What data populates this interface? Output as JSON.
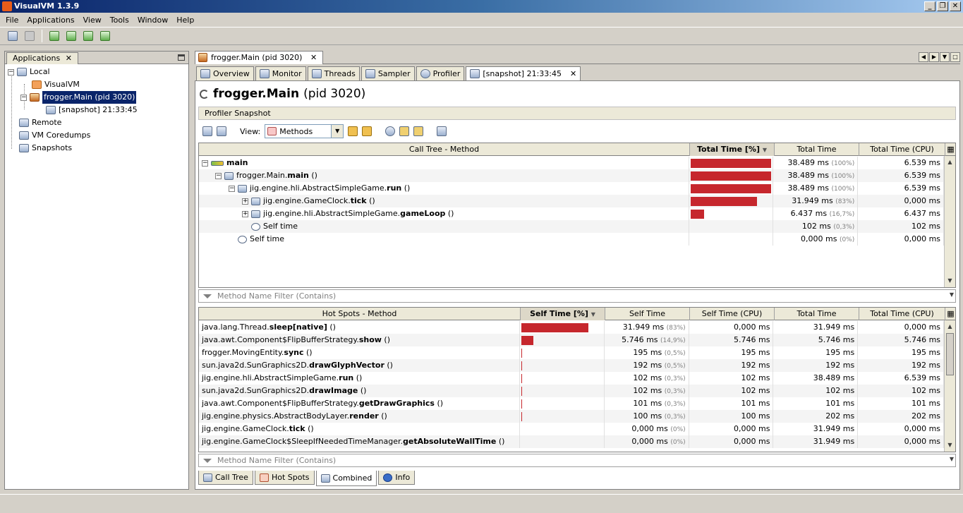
{
  "window": {
    "title": "VisualVM 1.3.9",
    "controls": [
      "_",
      "❐",
      "✕"
    ]
  },
  "menu": [
    "File",
    "Applications",
    "View",
    "Tools",
    "Window",
    "Help"
  ],
  "toolbar_icons": [
    "open-icon",
    "save-icon",
    "add-jmx-icon",
    "add-remote-icon",
    "add-coredump-icon",
    "add-snapshot-icon"
  ],
  "left_panel": {
    "tab_label": "Applications",
    "tab_close": "✕",
    "tree": [
      {
        "label": "Local",
        "level": 0,
        "expander": "−"
      },
      {
        "label": "VisualVM",
        "level": 1
      },
      {
        "label": "frogger.Main (pid 3020)",
        "level": 1,
        "expander": "−",
        "selected": true
      },
      {
        "label": "[snapshot] 21:33:45",
        "level": 2
      },
      {
        "label": "Remote",
        "level": 0
      },
      {
        "label": "VM Coredumps",
        "level": 0
      },
      {
        "label": "Snapshots",
        "level": 0
      }
    ]
  },
  "doc_tab": {
    "label": "frogger.Main (pid 3020)",
    "close": "✕",
    "nav": [
      "◀",
      "▶",
      "▼",
      "□"
    ]
  },
  "sub_tabs": [
    {
      "label": "Overview"
    },
    {
      "label": "Monitor"
    },
    {
      "label": "Threads"
    },
    {
      "label": "Sampler"
    },
    {
      "label": "Profiler"
    },
    {
      "label": "[snapshot] 21:33:45",
      "close": "✕",
      "active": true
    }
  ],
  "page": {
    "title_bold": "frogger.Main",
    "title_rest": "(pid 3020)",
    "section": "Profiler Snapshot",
    "view_label": "View:",
    "view_value": "Methods"
  },
  "call_tree": {
    "headers": [
      "Call Tree - Method",
      "Total Time [%]",
      "Total Time",
      "Total Time (CPU)"
    ],
    "sort_arrow": "▼",
    "rows": [
      {
        "prefix": "",
        "bold": "main",
        "suffix": "",
        "indent": 0,
        "expander": "−",
        "icon": "thread-icon",
        "pct": 100,
        "time": "38.489 ms",
        "pct_label": "(100%)",
        "cpu": "6.539 ms"
      },
      {
        "prefix": "frogger.Main.",
        "bold": "main",
        "suffix": " ()",
        "indent": 1,
        "expander": "−",
        "icon": "method-icon",
        "pct": 100,
        "time": "38.489 ms",
        "pct_label": "(100%)",
        "cpu": "6.539 ms"
      },
      {
        "prefix": "jig.engine.hli.AbstractSimpleGame.",
        "bold": "run",
        "suffix": " ()",
        "indent": 2,
        "expander": "−",
        "icon": "method-icon",
        "pct": 100,
        "time": "38.489 ms",
        "pct_label": "(100%)",
        "cpu": "6.539 ms"
      },
      {
        "prefix": "jig.engine.GameClock.",
        "bold": "tick",
        "suffix": " ()",
        "indent": 3,
        "expander": "+",
        "icon": "method-icon",
        "pct": 83,
        "time": "31.949 ms",
        "pct_label": "(83%)",
        "cpu": "0,000 ms"
      },
      {
        "prefix": "jig.engine.hli.AbstractSimpleGame.",
        "bold": "gameLoop",
        "suffix": " ()",
        "indent": 3,
        "expander": "+",
        "icon": "method-icon",
        "pct": 16.7,
        "time": "6.437 ms",
        "pct_label": "(16,7%)",
        "cpu": "6.437 ms"
      },
      {
        "prefix": "Self time",
        "bold": "",
        "suffix": "",
        "indent": 3,
        "expander": "",
        "icon": "clock-icon",
        "pct": 0.3,
        "time": "102 ms",
        "pct_label": "(0,3%)",
        "cpu": "102 ms"
      },
      {
        "prefix": "Self time",
        "bold": "",
        "suffix": "",
        "indent": 2,
        "expander": "",
        "icon": "clock-icon",
        "pct": 0,
        "time": "0,000 ms",
        "pct_label": "(0%)",
        "cpu": "0,000 ms"
      }
    ]
  },
  "filter_placeholder": "Method Name Filter (Contains)",
  "hot_spots": {
    "headers": [
      "Hot Spots - Method",
      "Self Time [%]",
      "Self Time",
      "Self Time (CPU)",
      "Total Time",
      "Total Time (CPU)"
    ],
    "sort_arrow": "▼",
    "rows": [
      {
        "prefix": "java.lang.Thread.",
        "bold": "sleep[native]",
        "suffix": " ()",
        "pct": 83,
        "self": "31.949 ms",
        "pct_label": "(83%)",
        "self_cpu": "0,000 ms",
        "total": "31.949 ms",
        "total_cpu": "0,000 ms"
      },
      {
        "prefix": "java.awt.Component$FlipBufferStrategy.",
        "bold": "show",
        "suffix": " ()",
        "pct": 14.9,
        "self": "5.746 ms",
        "pct_label": "(14,9%)",
        "self_cpu": "5.746 ms",
        "total": "5.746 ms",
        "total_cpu": "5.746 ms"
      },
      {
        "prefix": "frogger.MovingEntity.",
        "bold": "sync",
        "suffix": " ()",
        "pct": 0.5,
        "self": "195 ms",
        "pct_label": "(0,5%)",
        "self_cpu": "195 ms",
        "total": "195 ms",
        "total_cpu": "195 ms"
      },
      {
        "prefix": "sun.java2d.SunGraphics2D.",
        "bold": "drawGlyphVector",
        "suffix": " ()",
        "pct": 0.5,
        "self": "192 ms",
        "pct_label": "(0,5%)",
        "self_cpu": "192 ms",
        "total": "192 ms",
        "total_cpu": "192 ms"
      },
      {
        "prefix": "jig.engine.hli.AbstractSimpleGame.",
        "bold": "run",
        "suffix": " ()",
        "pct": 0.3,
        "self": "102 ms",
        "pct_label": "(0,3%)",
        "self_cpu": "102 ms",
        "total": "38.489 ms",
        "total_cpu": "6.539 ms"
      },
      {
        "prefix": "sun.java2d.SunGraphics2D.",
        "bold": "drawImage",
        "suffix": " ()",
        "pct": 0.3,
        "self": "102 ms",
        "pct_label": "(0,3%)",
        "self_cpu": "102 ms",
        "total": "102 ms",
        "total_cpu": "102 ms"
      },
      {
        "prefix": "java.awt.Component$FlipBufferStrategy.",
        "bold": "getDrawGraphics",
        "suffix": " ()",
        "pct": 0.3,
        "self": "101 ms",
        "pct_label": "(0,3%)",
        "self_cpu": "101 ms",
        "total": "101 ms",
        "total_cpu": "101 ms"
      },
      {
        "prefix": "jig.engine.physics.AbstractBodyLayer.",
        "bold": "render",
        "suffix": " ()",
        "pct": 0.3,
        "self": "100 ms",
        "pct_label": "(0,3%)",
        "self_cpu": "100 ms",
        "total": "202 ms",
        "total_cpu": "202 ms"
      },
      {
        "prefix": "jig.engine.GameClock.",
        "bold": "tick",
        "suffix": " ()",
        "pct": 0,
        "self": "0,000 ms",
        "pct_label": "(0%)",
        "self_cpu": "0,000 ms",
        "total": "31.949 ms",
        "total_cpu": "0,000 ms"
      },
      {
        "prefix": "jig.engine.GameClock$SleepIfNeededTimeManager.",
        "bold": "getAbsoluteWallTime",
        "suffix": " ()",
        "pct": 0,
        "self": "0,000 ms",
        "pct_label": "(0%)",
        "self_cpu": "0,000 ms",
        "total": "31.949 ms",
        "total_cpu": "0,000 ms"
      }
    ]
  },
  "bottom_tabs": [
    {
      "label": "Call Tree"
    },
    {
      "label": "Hot Spots"
    },
    {
      "label": "Combined",
      "active": true
    },
    {
      "label": "Info"
    }
  ],
  "colors": {
    "bar": "#c6272d",
    "selection": "#0a246a"
  }
}
